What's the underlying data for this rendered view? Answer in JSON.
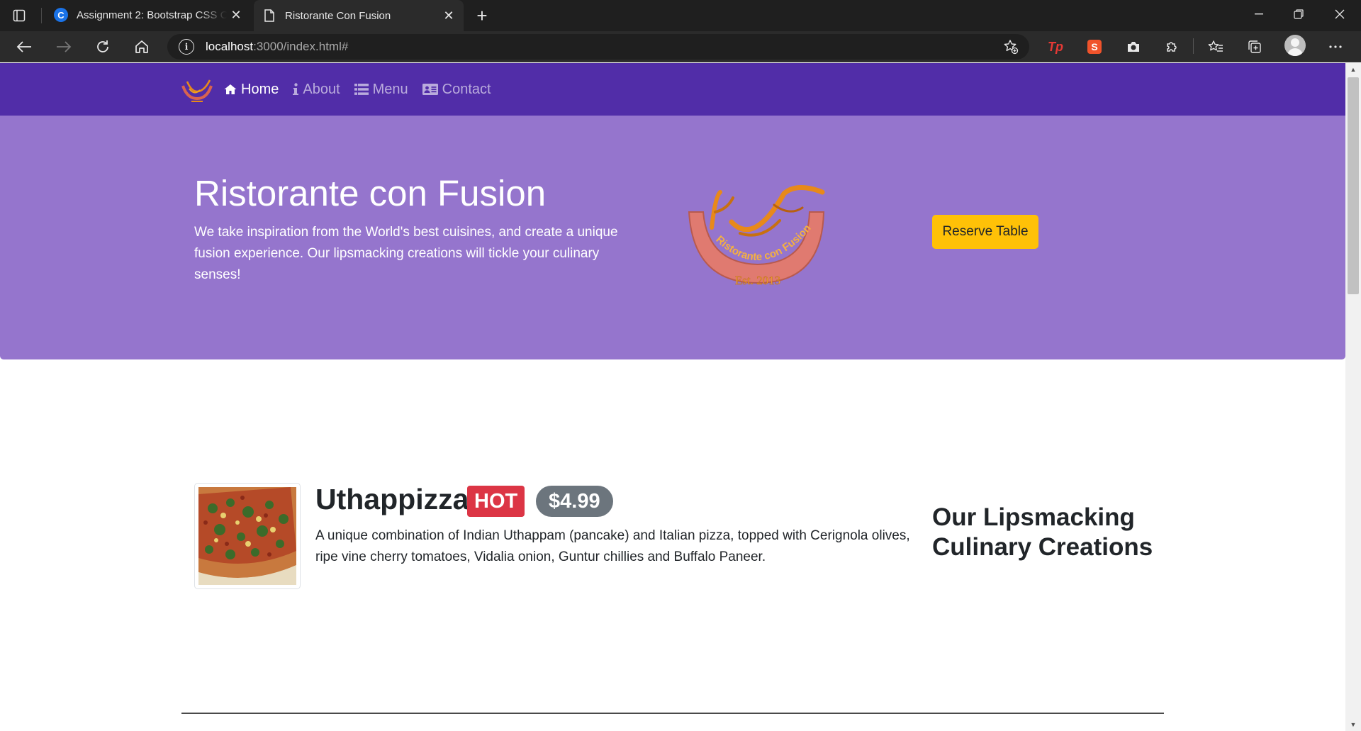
{
  "browser": {
    "tabs": [
      {
        "title": "Assignment 2: Bootstrap CSS Components",
        "favicon": "coursera-icon",
        "active": false
      },
      {
        "title": "Ristorante Con Fusion",
        "favicon": "page-icon",
        "active": true
      }
    ],
    "url_host": "localhost",
    "url_path": ":3000/index.html#",
    "extensions": [
      "tp-extension-icon",
      "s-extension-icon",
      "camera-icon",
      "puzzle-icon"
    ],
    "ext_tp_label": "Tp",
    "ext_s_label": "S"
  },
  "navbar": {
    "links": [
      {
        "label": "Home",
        "icon": "home-icon",
        "active": true
      },
      {
        "label": "About",
        "icon": "info-icon",
        "active": false
      },
      {
        "label": "Menu",
        "icon": "list-icon",
        "active": false
      },
      {
        "label": "Contact",
        "icon": "address-card-icon",
        "active": false
      }
    ]
  },
  "jumbotron": {
    "title": "Ristorante con Fusion",
    "text": "We take inspiration from the World's best cuisines, and create a unique fusion experience. Our lipsmacking creations will tickle your culinary senses!",
    "logo_text": "Ristorante con Fusion",
    "logo_est": "Est. 2013",
    "reserve_label": "Reserve Table"
  },
  "featured": {
    "dish_name": "Uthappizza",
    "badge": "HOT",
    "price": "$4.99",
    "description": "A unique combination of Indian Uthappam (pancake) and Italian pizza, topped with Cerignola olives, ripe vine cherry tomatoes, Vidalia onion, Guntur chillies and Buffalo Paneer."
  },
  "section_heading": "Our Lipsmacking Culinary Creations",
  "colors": {
    "navbar": "#512da8",
    "jumbotron": "#9575cd",
    "reserve_button": "#ffc107",
    "badge_hot": "#dc3545",
    "badge_price": "#6c757d"
  }
}
